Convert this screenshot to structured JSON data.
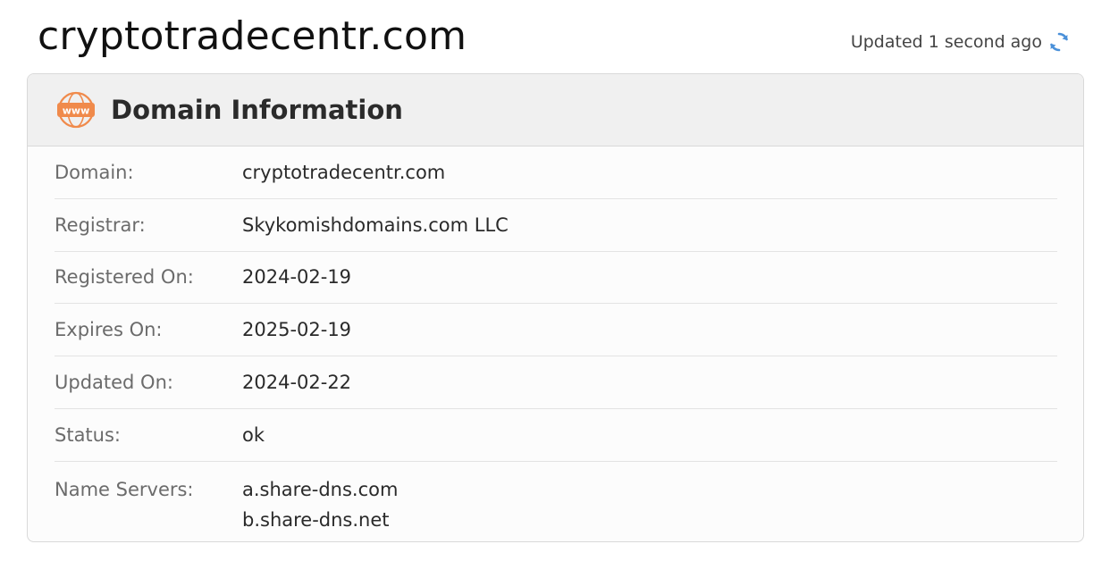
{
  "page": {
    "title": "cryptotradecentr.com",
    "updated_text": "Updated 1 second ago"
  },
  "icons": {
    "refresh": "refresh-icon",
    "www": "www-globe-icon"
  },
  "colors": {
    "accent_orange": "#f08a4b",
    "refresh_blue": "#4a90d9"
  },
  "card": {
    "title": "Domain Information",
    "rows": [
      {
        "label": "Domain:",
        "value": "cryptotradecentr.com"
      },
      {
        "label": "Registrar:",
        "value": "Skykomishdomains.com LLC"
      },
      {
        "label": "Registered On:",
        "value": "2024-02-19"
      },
      {
        "label": "Expires On:",
        "value": "2025-02-19"
      },
      {
        "label": "Updated On:",
        "value": "2024-02-22"
      },
      {
        "label": "Status:",
        "value": "ok"
      }
    ],
    "name_servers": {
      "label": "Name Servers:",
      "values": [
        "a.share-dns.com",
        "b.share-dns.net"
      ]
    }
  }
}
